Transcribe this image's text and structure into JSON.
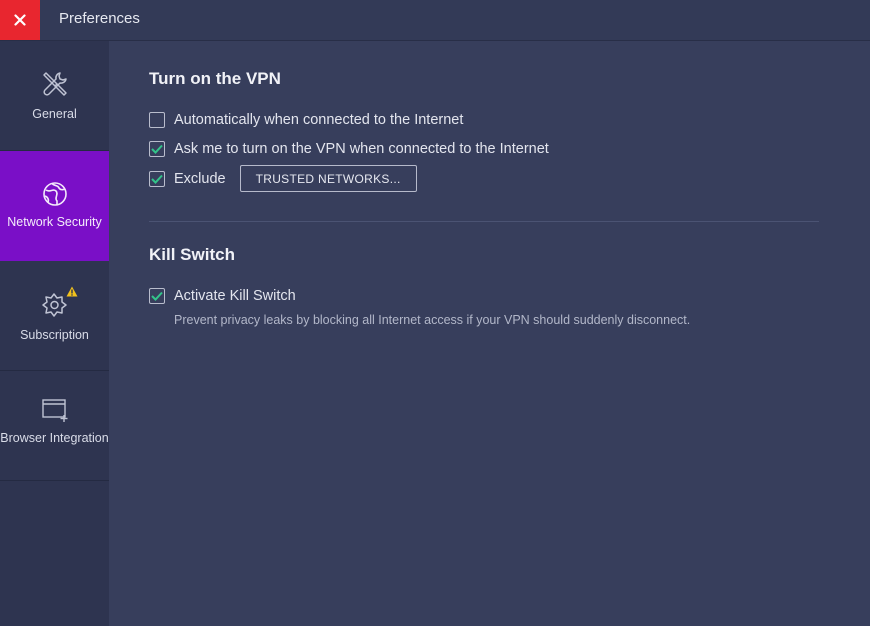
{
  "window": {
    "title": "Preferences"
  },
  "sidebar": {
    "items": [
      {
        "label": "General",
        "icon": "wrench-screwdriver-icon",
        "active": false
      },
      {
        "label": "Network Security",
        "icon": "globe-icon",
        "active": true
      },
      {
        "label": "Subscription",
        "icon": "subscription-gear-icon",
        "active": false,
        "warning": true
      },
      {
        "label": "Browser Integration",
        "icon": "browser-window-icon",
        "active": false
      }
    ]
  },
  "vpn": {
    "title": "Turn on the VPN",
    "options": [
      {
        "label": "Automatically when connected to the Internet",
        "checked": false
      },
      {
        "label": "Ask me to turn on the VPN when connected to the Internet",
        "checked": true
      },
      {
        "label": "Exclude",
        "checked": true
      }
    ],
    "trusted_button": "TRUSTED NETWORKS..."
  },
  "kill_switch": {
    "title": "Kill Switch",
    "option": {
      "label": "Activate Kill Switch",
      "checked": true
    },
    "description": "Prevent privacy leaks by blocking all Internet access if your VPN should suddenly disconnect."
  },
  "colors": {
    "accent": "#7a0fc7",
    "close": "#e8262f",
    "check": "#33c48a",
    "warning": "#f2c11c"
  }
}
